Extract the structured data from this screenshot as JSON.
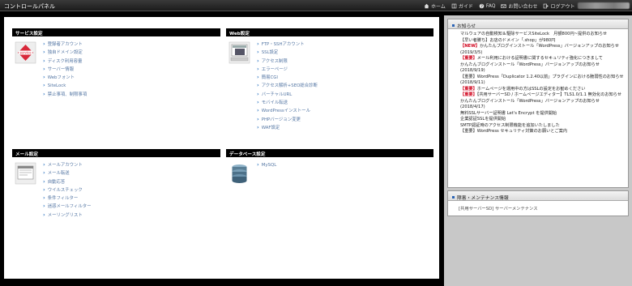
{
  "app": {
    "title": "コントロールパネル"
  },
  "topnav": [
    {
      "label": "ホーム",
      "icon": "home-icon"
    },
    {
      "label": "ガイド",
      "icon": "book-icon"
    },
    {
      "label": "FAQ",
      "icon": "question-icon"
    },
    {
      "label": "お問い合わせ",
      "icon": "mail-icon"
    },
    {
      "label": "ログアウト",
      "icon": "logout-icon"
    }
  ],
  "sections": {
    "service": {
      "title": "サービス設定",
      "image_label": "service",
      "links": [
        "登録者アカウント",
        "独自ドメイン設定",
        "ディスク利用容量",
        "サーバー情報",
        "Webフォント",
        "SiteLock",
        "禁止事項、制限事項"
      ]
    },
    "web": {
      "title": "Web設定",
      "links": [
        "FTP・SSHアカウント",
        "SSL設定",
        "アクセス制限",
        "エラーページ",
        "簡易CGI",
        "アクセス解析+SEO総合診断",
        "バーチャルURL",
        "モバイル転送",
        "WordPressインストール",
        "PHPバージョン変更",
        "WAF設定"
      ]
    },
    "mail": {
      "title": "メール設定",
      "links": [
        "メールアカウント",
        "メール転送",
        "自動応答",
        "ウイルスチェック",
        "条件フィルター",
        "迷惑メールフィルター",
        "メーリングリスト"
      ]
    },
    "db": {
      "title": "データベース設定",
      "links": [
        "MySQL"
      ]
    }
  },
  "news": {
    "title": "お知らせ",
    "items": [
      {
        "tag": "",
        "text": "マルウェアの自動検知＆駆除サービスSiteLock　月額800円~提供のお知らせ"
      },
      {
        "tag": "",
        "text": "【早い者勝ち】お店のドメイン「.shop」が980円"
      },
      {
        "tag": "【NEW】",
        "text": "かんたんブログインストール「WordPress」バージョンアップのお知らせ"
      },
      {
        "tag": "",
        "text": "(2019/3/5)"
      },
      {
        "tag": "【重要】",
        "text": "メール利用における証明書に関するセキュリティ強化につきまして"
      },
      {
        "tag": "",
        "text": "かんたんブログインストール「WordPress」バージョンアップのお知らせ"
      },
      {
        "tag": "",
        "text": "(2018/9/19)"
      },
      {
        "tag": "",
        "text": "【重要】WordPress「Duplicator 1.2.40以前」プラグインにおける脆弱性のお知らせ"
      },
      {
        "tag": "",
        "text": "(2018/9/11)"
      },
      {
        "tag": "【重要】",
        "text": "ホームページを運用中の方はSSLの設定をお勧めください"
      },
      {
        "tag": "【重要】",
        "text": "【共用サーバーSD / ホームページエディター】TLS1.0/1.1 無効化のお知らせ"
      },
      {
        "tag": "",
        "text": "かんたんブログインストール「WordPress」バージョンアップのお知らせ"
      },
      {
        "tag": "",
        "text": "(2018/4/17)"
      },
      {
        "tag": "",
        "text": "無料SSLサーバー証明書 Let's Encrypt を提供開始"
      },
      {
        "tag": "",
        "text": "企業認証SSLを提供開始"
      },
      {
        "tag": "",
        "text": "SMTP認証時のアクセス制限機能を追加いたしました"
      },
      {
        "tag": "",
        "text": "【重要】WordPress セキュリティ対策のお願いとご案内"
      }
    ]
  },
  "maintenance": {
    "title": "障害・メンテナンス情報",
    "text": "[共用サーバーSD] サーバーメンテナンス"
  },
  "colors": {
    "link": "#5577a4",
    "accent": "#2a64b6",
    "alert": "#d0021b"
  }
}
